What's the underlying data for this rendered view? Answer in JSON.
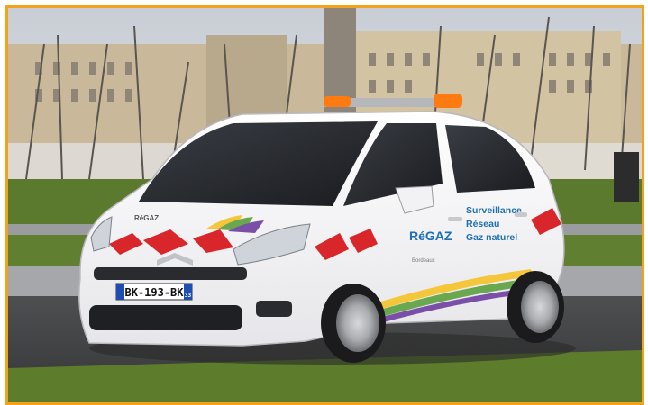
{
  "photo": {
    "plate": "BK-193-BK",
    "plate_region": "33",
    "hood_logo": "RéGAZ",
    "door_logo": "RéGAZ",
    "door_tagline": "Bordeaux",
    "door_service_lines": [
      "Surveillance",
      "Réseau",
      "Gaz naturel"
    ],
    "frame_color": "#f2a21b",
    "beacon_color": "#ff7a10",
    "stripe_red": "#d8262a",
    "text_blue": "#1f6fb3"
  }
}
